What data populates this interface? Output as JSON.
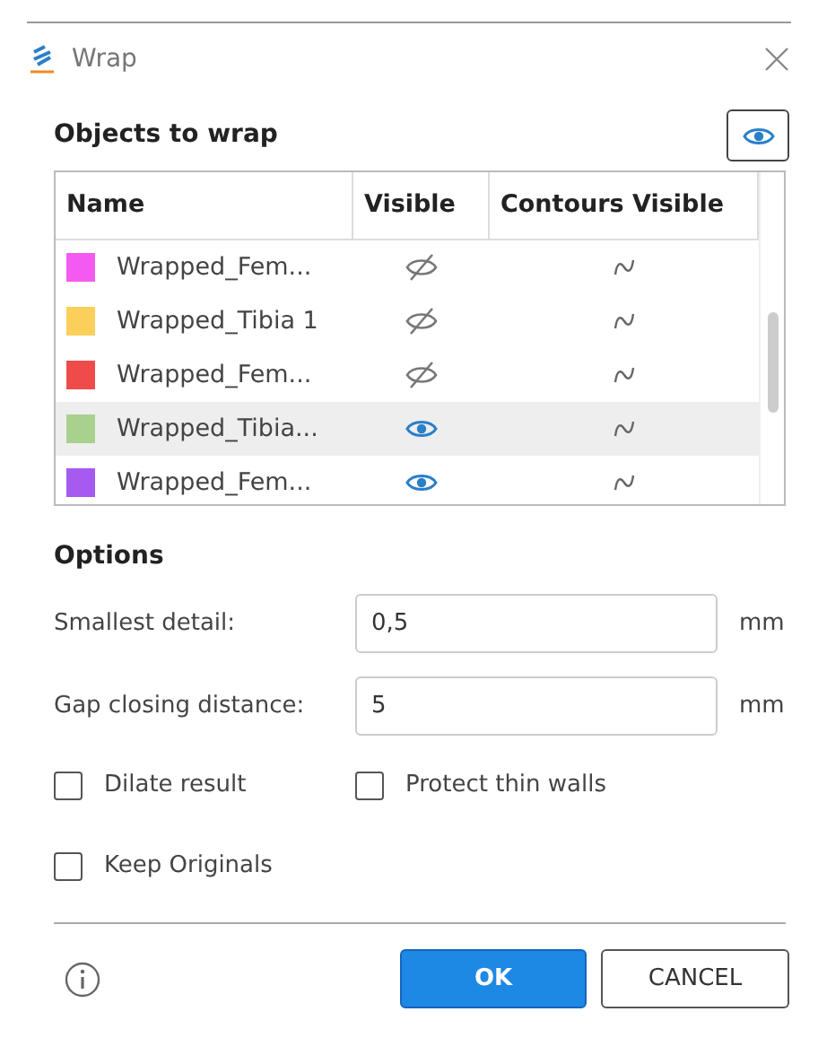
{
  "window": {
    "title": "Wrap"
  },
  "objects": {
    "title": "Objects to wrap",
    "columns": [
      "Name",
      "Visible",
      "Contours Visible"
    ],
    "rows": [
      {
        "name": "Wrapped_Fem...",
        "color": "#f55af0",
        "visible": false,
        "selected": false
      },
      {
        "name": "Wrapped_Tibia 1",
        "color": "#fbd05a",
        "visible": false,
        "selected": false
      },
      {
        "name": "Wrapped_Fem...",
        "color": "#f04b4b",
        "visible": false,
        "selected": false
      },
      {
        "name": "Wrapped_Tibia...",
        "color": "#a9d18e",
        "visible": true,
        "selected": true
      },
      {
        "name": "Wrapped_Fem...",
        "color": "#a65af0",
        "visible": true,
        "selected": false
      }
    ]
  },
  "options": {
    "title": "Options",
    "fields": [
      {
        "label": "Smallest detail:",
        "value": "0,5",
        "unit": "mm"
      },
      {
        "label": "Gap closing distance:",
        "value": "5",
        "unit": "mm"
      }
    ],
    "checkboxes": [
      {
        "label": "Dilate result",
        "checked": false
      },
      {
        "label": "Protect thin walls",
        "checked": false
      },
      {
        "label": "Keep Originals",
        "checked": false
      }
    ]
  },
  "buttons": [
    {
      "label": "OK",
      "kind": "primary"
    },
    {
      "label": "CANCEL",
      "kind": "secondary"
    }
  ]
}
